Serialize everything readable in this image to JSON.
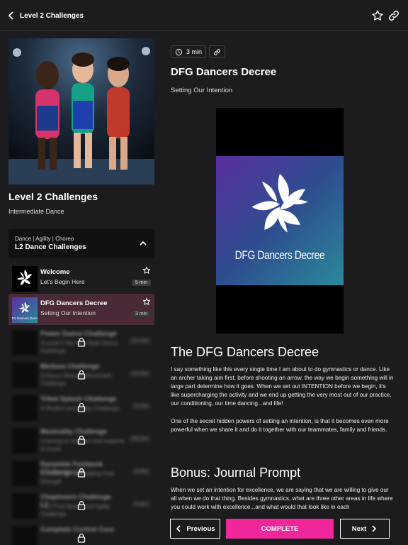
{
  "header": {
    "back_label": "Level 2 Challenges",
    "icons": [
      "chevron-left-icon",
      "star-icon",
      "link-icon"
    ]
  },
  "course": {
    "title": "Level 2 Challenges",
    "subtitle": "Intermediate Dance"
  },
  "section": {
    "tags": "Dance | Agility | Choreo",
    "title": "L2 Dance Challenges"
  },
  "lessons": [
    {
      "title": "Welcome",
      "subtitle": "Let's Begin Here",
      "duration": "5 min",
      "active": false
    },
    {
      "title": "DFG Dancers Decree",
      "subtitle": "Setting Our Intention",
      "duration": "3 min",
      "active": true
    }
  ],
  "locked_lessons": [
    {
      "title": "Power Dance Challenge",
      "subtitle": "A Level 2 Hip Hop Style Dance Challenge",
      "duration": "10 min"
    },
    {
      "title": "Medusa Challenge",
      "subtitle": "A Dance Medusa Movement Challenge",
      "duration": "14 min"
    },
    {
      "title": "Tribal Splash Challenge",
      "subtitle": "A Rhythm and Agility Challenge",
      "duration": "9 min"
    },
    {
      "title": "Musicality Challenge",
      "subtitle": "Learning to interpret and respond to music",
      "duration": "30 min"
    },
    {
      "title": "Dynamite Footwork Challenge L2",
      "subtitle": "A Challenge for Building Foot Strength",
      "duration": "8 min"
    },
    {
      "title": "Chapineers Challenge L2",
      "subtitle": "A L2 Foot Speed and Agility Challenge",
      "duration": "8 min"
    },
    {
      "title": "Complete Control Core",
      "subtitle": "",
      "duration": ""
    }
  ],
  "detail": {
    "duration": "3 min",
    "title": "DFG Dancers Decree",
    "subtitle": "Setting Our Intention",
    "video_art_text": "DFG Dancers Decree",
    "heading1": "The DFG Dancers Decree",
    "para1": "I say something like this every single time I am about to do gymnastics or dance. Like an archer taking aim first, before shooting an arrow, the way we begin something will in large part determine how it goes. When we set out INTENTION before we begin, it's like supercharging the activity and we end up getting the very most out of our practice, our conditioning, our time dancing...and life!",
    "para2": "One of the secret hidden powers of setting an intention, is that it becomes even more powerful when we share it and do it together with our teammates, family and friends.",
    "heading2": "Bonus: Journal Prompt",
    "para3": "When we set an intention for excellence, we are saying that we are willing to give our all when we do that thing. Besides gymnastics, what are three other areas in life where you could work with excellence...and what would that look like in each"
  },
  "footer": {
    "prev_label": "Previous",
    "complete_label": "COMPLETE",
    "next_label": "Next"
  },
  "colors": {
    "accent": "#f0279a",
    "background": "#1c1c1e",
    "active_row": "#4a2a38"
  }
}
